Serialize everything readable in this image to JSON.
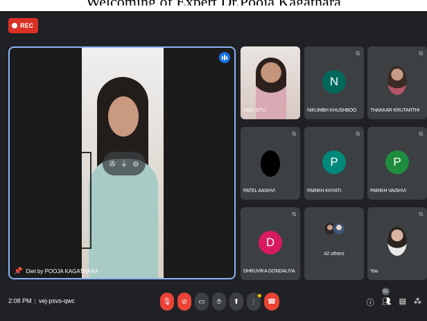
{
  "caption": "Welcoming of Expert Dr.Pooja Kagathara",
  "recording": {
    "label": "REC",
    "color": "#d93025"
  },
  "main_tile": {
    "name": "Diet by POOJA KAGATHARA",
    "border_color": "#8ab4f8",
    "icons": [
      "pin-icon",
      "speaking-icon",
      "hover-pin-icon",
      "hover-mute-icon",
      "hover-more-icon"
    ]
  },
  "tiles": [
    {
      "name": "VIDC GTU",
      "type": "video",
      "muted": true
    },
    {
      "name": "NIKUMBH KHUSHBOO",
      "initial": "N",
      "color": "#00695c",
      "muted": true
    },
    {
      "name": "THAKKAR KRUTARTHI",
      "type": "photo",
      "muted": true
    },
    {
      "name": "PATEL AASHVI",
      "initial": "",
      "color": "#000000",
      "muted": true
    },
    {
      "name": "PARIKH KHYATI",
      "initial": "P",
      "color": "#00897b",
      "muted": true
    },
    {
      "name": "PARIKH VAISHVI",
      "initial": "P",
      "color": "#1e8e3e",
      "muted": true
    },
    {
      "name": "DHRUVIKA GONDALIYA",
      "initial": "D",
      "color": "#d81b60",
      "muted": true
    },
    {
      "name": "42 others",
      "type": "group"
    },
    {
      "name": "You",
      "type": "photo",
      "muted": true
    }
  ],
  "bottom_bar": {
    "time": "2:08 PM",
    "meeting_code": "vej-psvs-qwc",
    "participants_count": "51",
    "controls": [
      "mic-off-icon",
      "camera-off-icon",
      "captions-icon",
      "raise-hand-icon",
      "present-icon",
      "more-icon",
      "end-call-icon"
    ],
    "right": [
      "info-icon",
      "people-icon",
      "chat-icon",
      "activities-icon"
    ]
  }
}
